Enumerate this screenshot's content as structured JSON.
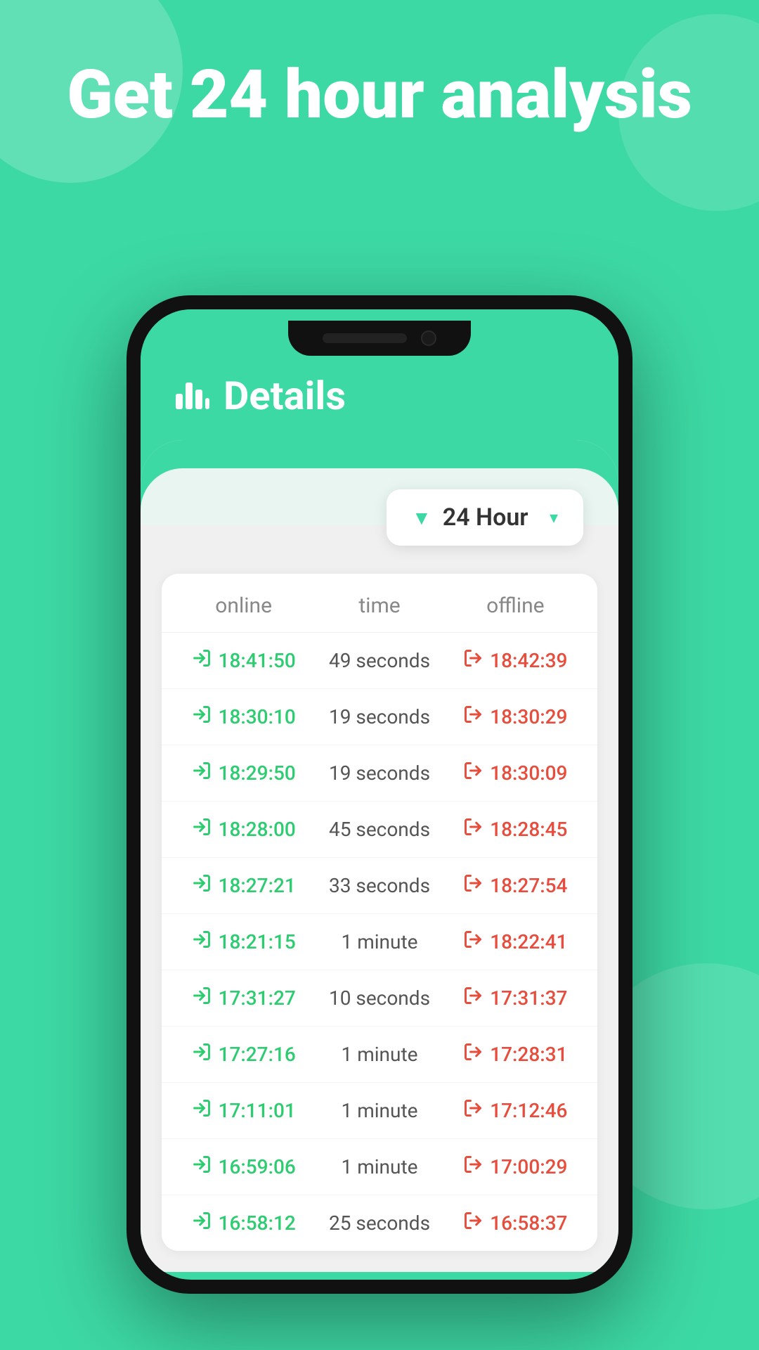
{
  "background": {
    "color": "#3DD9A4"
  },
  "hero": {
    "title": "Get 24 hour analysis"
  },
  "phone": {
    "header": {
      "icon_label": "chart-bar-icon",
      "title": "Details"
    },
    "filter": {
      "label": "24 Hour",
      "chevron": "▾"
    },
    "table": {
      "columns": [
        {
          "key": "online",
          "label": "online"
        },
        {
          "key": "time",
          "label": "time"
        },
        {
          "key": "offline",
          "label": "offline"
        }
      ],
      "rows": [
        {
          "online": "18:41:50",
          "time": "49 seconds",
          "offline": "18:42:39"
        },
        {
          "online": "18:30:10",
          "time": "19 seconds",
          "offline": "18:30:29"
        },
        {
          "online": "18:29:50",
          "time": "19 seconds",
          "offline": "18:30:09"
        },
        {
          "online": "18:28:00",
          "time": "45 seconds",
          "offline": "18:28:45"
        },
        {
          "online": "18:27:21",
          "time": "33 seconds",
          "offline": "18:27:54"
        },
        {
          "online": "18:21:15",
          "time": "1 minute",
          "offline": "18:22:41"
        },
        {
          "online": "17:31:27",
          "time": "10 seconds",
          "offline": "17:31:37"
        },
        {
          "online": "17:27:16",
          "time": "1 minute",
          "offline": "17:28:31"
        },
        {
          "online": "17:11:01",
          "time": "1 minute",
          "offline": "17:12:46"
        },
        {
          "online": "16:59:06",
          "time": "1 minute",
          "offline": "17:00:29"
        },
        {
          "online": "16:58:12",
          "time": "25 seconds",
          "offline": "16:58:37"
        }
      ]
    }
  }
}
